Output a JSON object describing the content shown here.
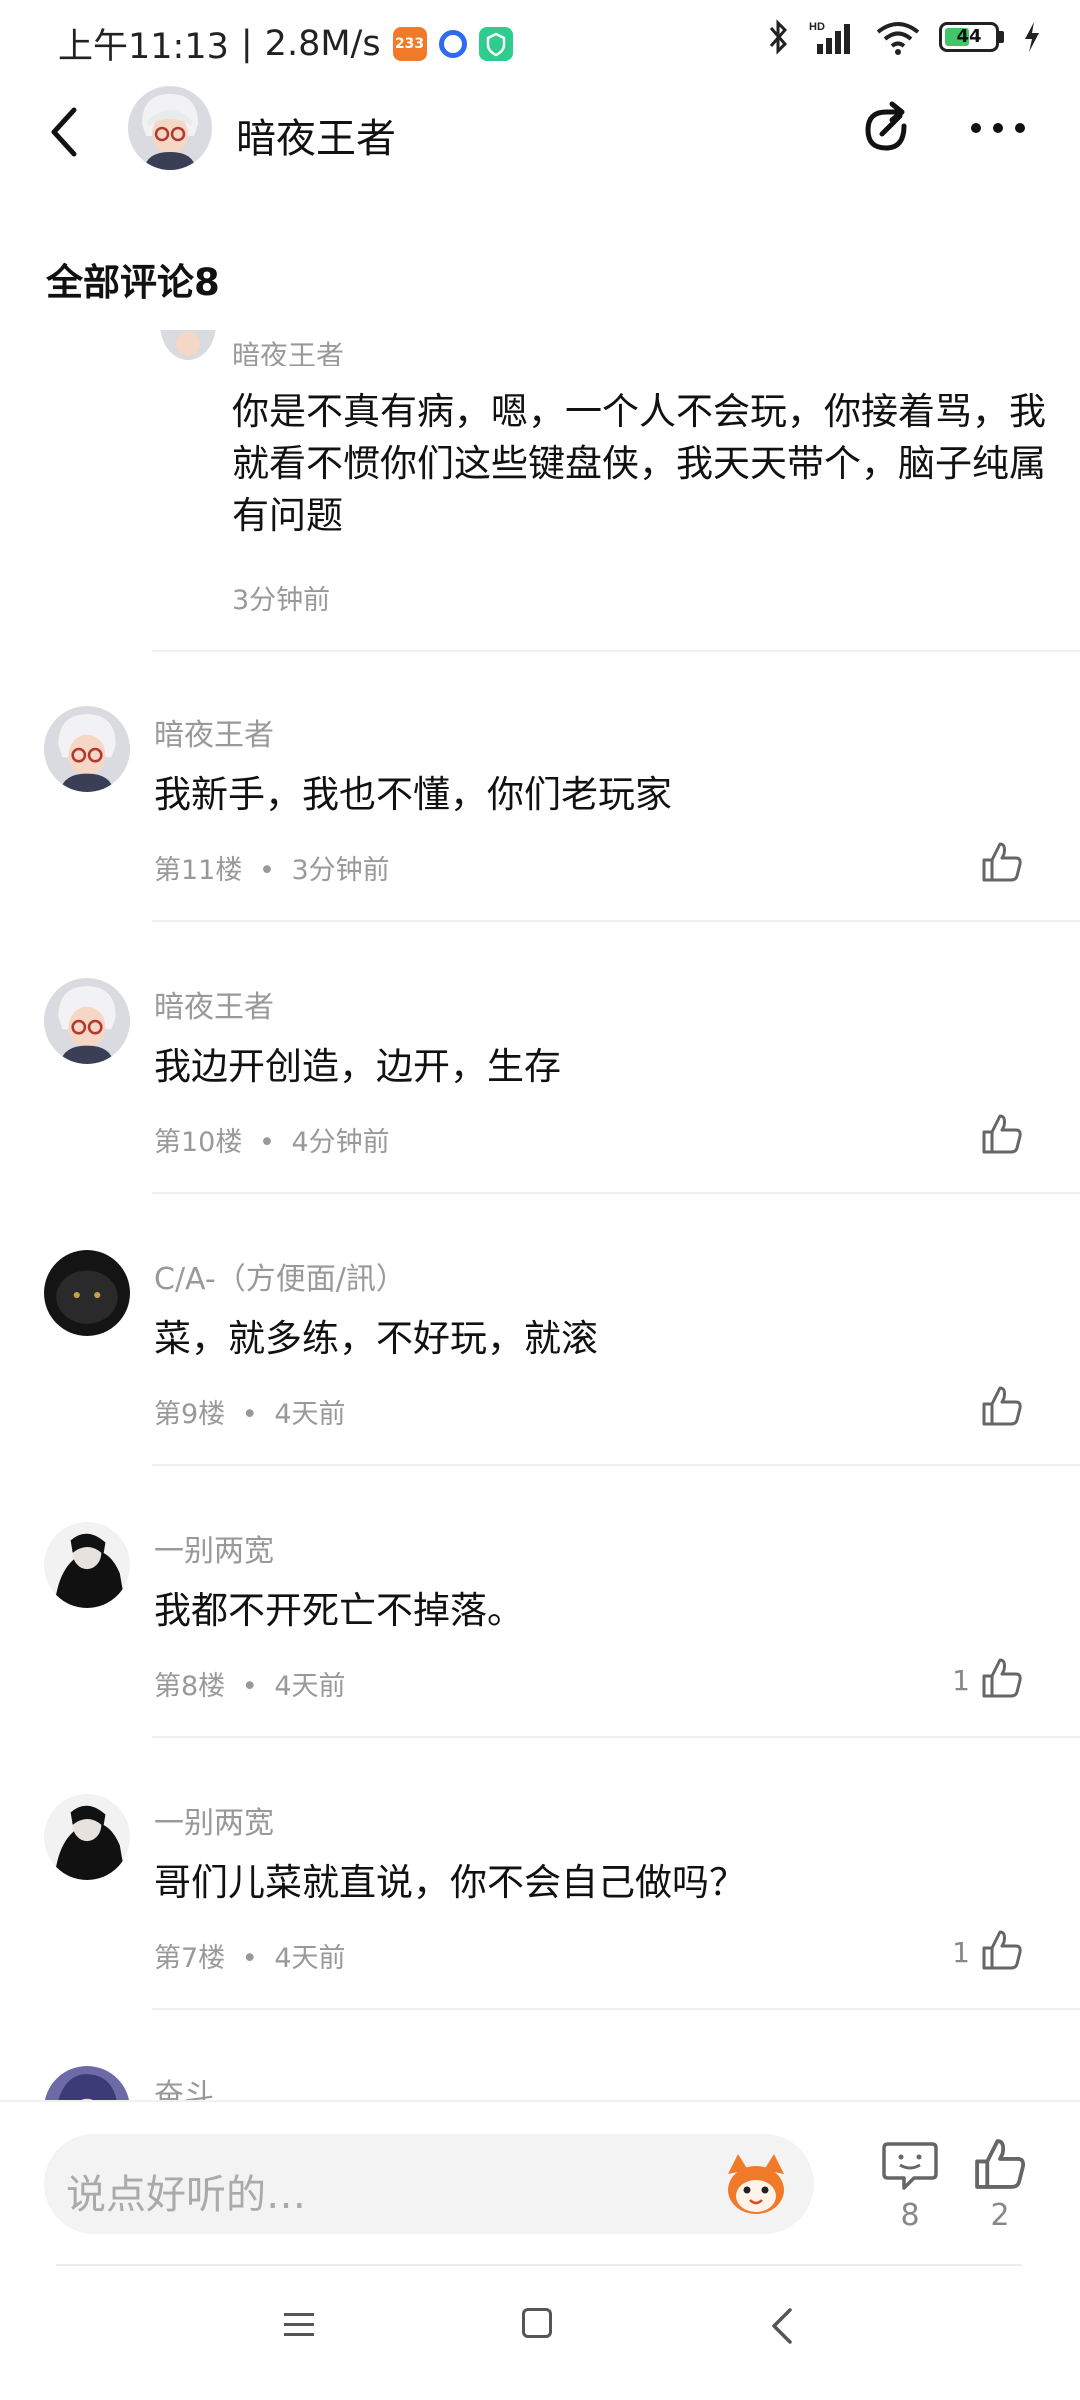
{
  "status_bar": {
    "time": "上午11:13",
    "separator": "|",
    "speed": "2.8M/s",
    "app_badge": "233",
    "battery": "44"
  },
  "header": {
    "title": "暗夜王者",
    "icons": {
      "back": "back-arrow-icon",
      "share": "share-icon",
      "more": "more-dots-icon"
    }
  },
  "section_title": "全部评论8",
  "thread": {
    "partial_name": "暗夜王者",
    "reply_text": "你是不真有病，嗯，一个人不会玩，你接着骂，我就看不惯你们这些键盘侠，我天天带个，脑子纯属有问题",
    "reply_time": "3分钟前"
  },
  "comments": [
    {
      "name": "暗夜王者",
      "text": "我新手，我也不懂，你们老玩家",
      "floor": "第11楼",
      "time": "3分钟前",
      "likes": ""
    },
    {
      "name": "暗夜王者",
      "text": "我边开创造，边开，生存",
      "floor": "第10楼",
      "time": "4分钟前",
      "likes": ""
    },
    {
      "name": "C/A-（方便面/訊）",
      "text": "菜，就多练，不好玩，就滚",
      "floor": "第9楼",
      "time": "4天前",
      "likes": ""
    },
    {
      "name": "一别两宽",
      "text": "我都不开死亡不掉落。",
      "floor": "第8楼",
      "time": "4天前",
      "likes": "1"
    },
    {
      "name": "一别两宽",
      "text": "哥们儿菜就直说，你不会自己做吗？",
      "floor": "第7楼",
      "time": "4天前",
      "likes": "1"
    },
    {
      "name": "奋斗",
      "text": "",
      "floor": "",
      "time": "",
      "likes": ""
    }
  ],
  "meta_separator": "•",
  "bottom_bar": {
    "input_placeholder": "说点好听的…",
    "comment_count": "8",
    "like_count": "2"
  },
  "colors": {
    "accent_like": "#666666",
    "meta_gray": "#999999"
  }
}
